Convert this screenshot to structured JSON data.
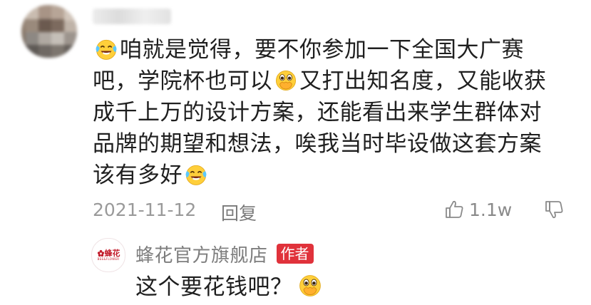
{
  "comment": {
    "lines": [
      "咱就是觉得，要不你参加一下全国大广赛",
      "吧，学院杯也可以",
      "又打出知名度，又能收获",
      "成千上万的设计方案，还能看出来学生群体对",
      "品牌的期望和想法，唉我当时毕设做这套方案",
      "该有多好"
    ],
    "date": "2021-11-12",
    "reply_label": "回复",
    "like_count": "1.1w"
  },
  "reply": {
    "avatar_logo_text": "蜂花",
    "avatar_logo_sub": "BEE&FLOWER",
    "author_name": "蜂花官方旗舰店",
    "author_badge": "作者",
    "text": "这个要花钱吧？"
  },
  "icons": {
    "laughing_emoji": "laugh-cry-emoji",
    "shy_emoji": "hand-over-mouth-emoji",
    "like": "thumbs-up-icon",
    "dislike": "thumbs-down-icon"
  },
  "colors": {
    "badge": "#e0323b",
    "brand": "#c21b2a",
    "meta": "#9a9a9a"
  }
}
